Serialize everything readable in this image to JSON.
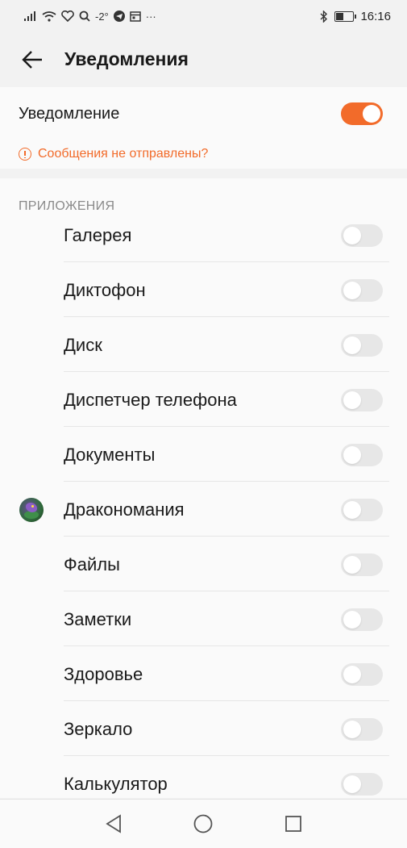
{
  "status_bar": {
    "temperature": "-2°",
    "more": "···",
    "time": "16:16",
    "battery_level": 0.5,
    "icons": [
      "signal-icon",
      "wifi-icon",
      "health-icon",
      "search-icon",
      "telegram-icon",
      "calendar-icon",
      "bluetooth-icon",
      "battery-icon"
    ]
  },
  "header": {
    "title": "Уведомления",
    "back_icon": "back-arrow-icon"
  },
  "notification": {
    "label": "Уведомление",
    "enabled": true,
    "warning_text": "Сообщения не отправлены?",
    "warning_icon": "alert-circle-icon"
  },
  "apps_section": {
    "header": "ПРИЛОЖЕНИЯ",
    "items": [
      {
        "label": "Галерея",
        "enabled": false
      },
      {
        "label": "Диктофон",
        "enabled": false
      },
      {
        "label": "Диск",
        "enabled": false
      },
      {
        "label": "Диспетчер телефона",
        "enabled": false
      },
      {
        "label": "Документы",
        "enabled": false
      },
      {
        "label": "Дракономания",
        "enabled": false,
        "icon": "dragon-app-icon"
      },
      {
        "label": "Файлы",
        "enabled": false
      },
      {
        "label": "Заметки",
        "enabled": false
      },
      {
        "label": "Здоровье",
        "enabled": false
      },
      {
        "label": "Зеркало",
        "enabled": false
      },
      {
        "label": "Калькулятор",
        "enabled": false
      }
    ]
  },
  "nav_bar": {
    "buttons": [
      "nav-back-icon",
      "nav-home-icon",
      "nav-recent-icon"
    ]
  },
  "colors": {
    "accent": "#f26b2a",
    "background": "#f2f2f2",
    "card": "#fafafa",
    "toggle_off": "#e7e7e7",
    "section_header": "#8a8a8a"
  }
}
